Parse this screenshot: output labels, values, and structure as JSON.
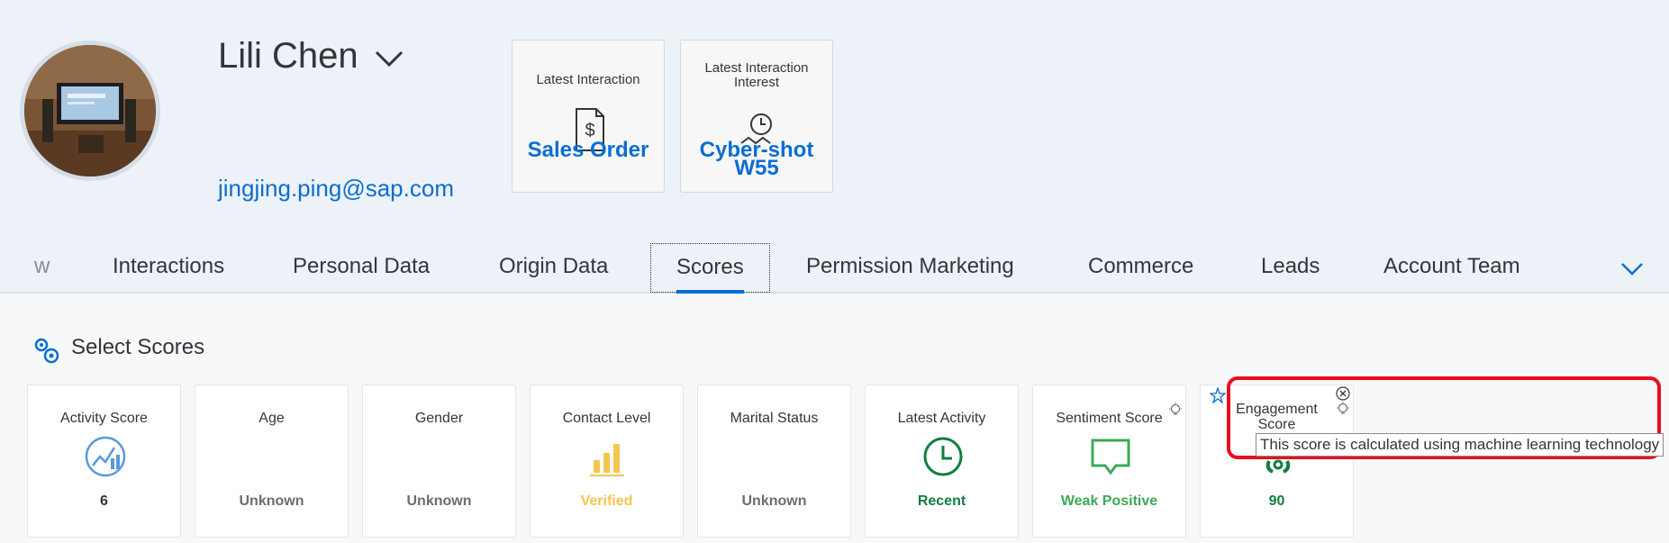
{
  "profile": {
    "name": "Lili Chen",
    "email": "jingjing.ping@sap.com"
  },
  "header_cards": [
    {
      "title": "Latest Interaction",
      "value": "Sales Order",
      "icon": "document-dollar-icon"
    },
    {
      "title": "Latest Interaction Interest",
      "value": "Cyber-shot W55",
      "icon": "clock-trend-icon"
    }
  ],
  "tabs": [
    {
      "label": "w"
    },
    {
      "label": "Interactions"
    },
    {
      "label": "Personal Data"
    },
    {
      "label": "Origin Data"
    },
    {
      "label": "Scores",
      "active": true
    },
    {
      "label": "Permission Marketing"
    },
    {
      "label": "Commerce"
    },
    {
      "label": "Leads"
    },
    {
      "label": "Account Team"
    }
  ],
  "section": {
    "title": "Select Scores"
  },
  "scores": [
    {
      "title": "Activity Score",
      "value": "6",
      "color": "#32363a",
      "icon": "activity-score-icon"
    },
    {
      "title": "Age",
      "value": "Unknown",
      "color": "#6a6d70"
    },
    {
      "title": "Gender",
      "value": "Unknown",
      "color": "#6a6d70"
    },
    {
      "title": "Contact Level",
      "value": "Verified",
      "color": "#f4c64f",
      "icon": "bar-chart-icon"
    },
    {
      "title": "Marital Status",
      "value": "Unknown",
      "color": "#6a6d70"
    },
    {
      "title": "Latest Activity",
      "value": "Recent",
      "color": "#107e3e",
      "icon": "clock-icon"
    },
    {
      "title": "Sentiment Score",
      "value": "Weak Positive",
      "color": "#3ea858",
      "icon": "speech-bubble-icon"
    },
    {
      "title": "Engagement Score",
      "value": "90",
      "color": "#107e3e",
      "icon": "engagement-icon"
    }
  ],
  "tooltip": {
    "text": "This score is calculated using machine learning technology"
  },
  "colors": {
    "accent": "#0a6ed1",
    "highlight": "#e8101e",
    "header_bg": "#edf2f8"
  }
}
